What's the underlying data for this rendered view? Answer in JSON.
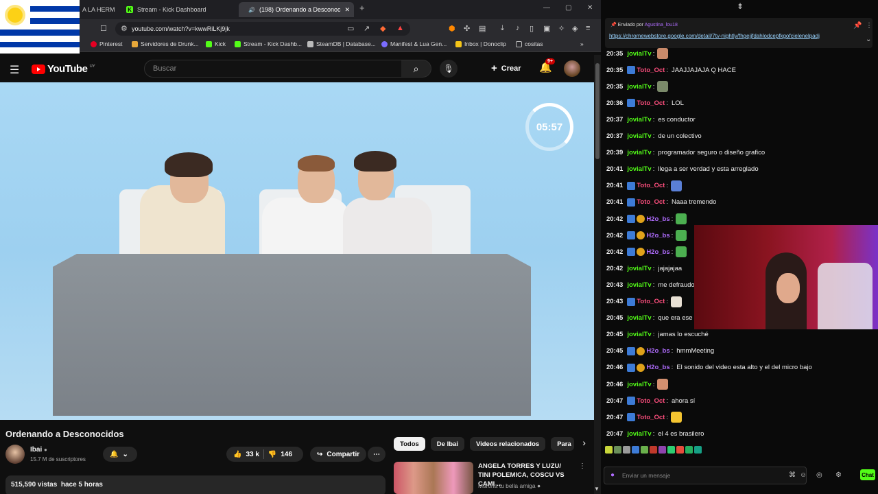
{
  "browser": {
    "tabs": [
      {
        "label": "A LA HERM",
        "active": false
      },
      {
        "label": "Stream - Kick Dashboard",
        "active": false
      },
      {
        "label": "(198) Ordenando a Desconoc",
        "active": true
      }
    ],
    "url": "youtube.com/watch?v=kwwRiLKj9jk",
    "bookmarks": [
      "Pinterest",
      "Servidores de Drunk...",
      "Kick",
      "Stream - Kick Dashb...",
      "SteamDB | Database...",
      "Manifest & Lua Gen...",
      "Inbox | Donoclip",
      "cositas"
    ]
  },
  "youtube": {
    "logo": "YouTube",
    "country": "UY",
    "search_placeholder": "Buscar",
    "create_label": "Crear",
    "notif_badge": "9+"
  },
  "video": {
    "timer": "05:57",
    "title": "Ordenando a Desconocidos",
    "channel": "Ibai",
    "subscribers": "15.7 M de suscriptores",
    "likes": "33 k",
    "dislikes": "146",
    "share_label": "Compartir",
    "views": "515,590 vistas",
    "age": "hace 5 horas"
  },
  "recommendations": {
    "chips": [
      "Todos",
      "De Ibai",
      "Videos relacionados",
      "Para"
    ],
    "item": {
      "title": "ANGELA TORRES Y LUZU/ TINI POLEMICA, COSCU VS CAMI ...",
      "channel": "Martina tu bella amiga"
    }
  },
  "chat": {
    "pinned_by_label": "Enviado por",
    "pinned_user": "Agustina_lou18",
    "pinned_link": "https://chromewebstore.google.com/detail/7tv-nightly/fhgejjfdahlodcepfkgofcielenelpadj",
    "input_placeholder": "Enviar un mensaje",
    "send_label": "Chat",
    "messages": [
      {
        "time": "20:35",
        "user": "jovialTv",
        "text": "",
        "color": "#53fc18",
        "badge": false,
        "sub": false,
        "emote": "#c98a6a"
      },
      {
        "time": "20:35",
        "user": "Toto_Oct",
        "text": "JAAJJAJAJA Q HACE",
        "color": "#ff4f7e",
        "badge": true,
        "sub": false,
        "emote": ""
      },
      {
        "time": "20:35",
        "user": "jovialTv",
        "text": "",
        "color": "#53fc18",
        "badge": false,
        "sub": false,
        "emote": "#7b8a6a"
      },
      {
        "time": "20:36",
        "user": "Toto_Oct",
        "text": "LOL",
        "color": "#ff4f7e",
        "badge": true,
        "sub": false,
        "emote": ""
      },
      {
        "time": "20:37",
        "user": "jovialTv",
        "text": "es conductor",
        "color": "#53fc18",
        "badge": false,
        "sub": false,
        "emote": ""
      },
      {
        "time": "20:37",
        "user": "jovialTv",
        "text": "de un colectivo",
        "color": "#53fc18",
        "badge": false,
        "sub": false,
        "emote": ""
      },
      {
        "time": "20:39",
        "user": "jovialTv",
        "text": "programador seguro o diseño grafico",
        "color": "#53fc18",
        "badge": false,
        "sub": false,
        "emote": ""
      },
      {
        "time": "20:41",
        "user": "jovialTv",
        "text": "llega a ser verdad y esta arreglado",
        "color": "#53fc18",
        "badge": false,
        "sub": false,
        "emote": ""
      },
      {
        "time": "20:41",
        "user": "Toto_Oct",
        "text": "",
        "color": "#ff4f7e",
        "badge": true,
        "sub": false,
        "emote": "#5a7fd6"
      },
      {
        "time": "20:41",
        "user": "Toto_Oct",
        "text": "Naaa tremendo",
        "color": "#ff4f7e",
        "badge": true,
        "sub": false,
        "emote": ""
      },
      {
        "time": "20:42",
        "user": "H2o_bs",
        "text": "",
        "color": "#b06dff",
        "badge": true,
        "sub": true,
        "emote": "#4caf50"
      },
      {
        "time": "20:42",
        "user": "H2o_bs",
        "text": "",
        "color": "#b06dff",
        "badge": true,
        "sub": true,
        "emote": "#4caf50"
      },
      {
        "time": "20:42",
        "user": "H2o_bs",
        "text": "",
        "color": "#b06dff",
        "badge": true,
        "sub": true,
        "emote": "#4caf50"
      },
      {
        "time": "20:42",
        "user": "jovialTv",
        "text": "jajajajaa",
        "color": "#53fc18",
        "badge": false,
        "sub": false,
        "emote": ""
      },
      {
        "time": "20:43",
        "user": "jovialTv",
        "text": "me defraudo jajaja",
        "color": "#53fc18",
        "badge": false,
        "sub": false,
        "emote": ""
      },
      {
        "time": "20:43",
        "user": "Toto_Oct",
        "text": "",
        "color": "#ff4f7e",
        "badge": true,
        "sub": false,
        "emote": "#e8e0d4"
      },
      {
        "time": "20:45",
        "user": "jovialTv",
        "text": "que era ese *****",
        "color": "#53fc18",
        "badge": false,
        "sub": false,
        "emote": ""
      },
      {
        "time": "20:45",
        "user": "jovialTv",
        "text": "jamas lo escuché",
        "color": "#53fc18",
        "badge": false,
        "sub": false,
        "emote": ""
      },
      {
        "time": "20:45",
        "user": "H2o_bs",
        "text": "hmmMeeting",
        "color": "#b06dff",
        "badge": true,
        "sub": true,
        "emote": ""
      },
      {
        "time": "20:46",
        "user": "H2o_bs",
        "text": "El sonido del video esta alto y el del micro bajo",
        "color": "#b06dff",
        "badge": true,
        "sub": true,
        "emote": ""
      },
      {
        "time": "20:46",
        "user": "jovialTv",
        "text": "",
        "color": "#53fc18",
        "badge": false,
        "sub": false,
        "emote": "#d49070"
      },
      {
        "time": "20:47",
        "user": "Toto_Oct",
        "text": "ahora sí",
        "color": "#ff4f7e",
        "badge": true,
        "sub": false,
        "emote": ""
      },
      {
        "time": "20:47",
        "user": "Toto_Oct",
        "text": "",
        "color": "#ff4f7e",
        "badge": true,
        "sub": false,
        "emote": "#f4c430"
      },
      {
        "time": "20:47",
        "user": "jovialTv",
        "text": "el 4 es brasilero",
        "color": "#53fc18",
        "badge": false,
        "sub": false,
        "emote": ""
      }
    ],
    "emote_bar": [
      "#c8d63a",
      "#6a8f5a",
      "#9a9a9a",
      "#3d7bd6",
      "#6ab04c",
      "#c0392b",
      "#8e44ad",
      "#2ecc71",
      "#e74c3c",
      "#27ae60",
      "#16a085"
    ]
  }
}
